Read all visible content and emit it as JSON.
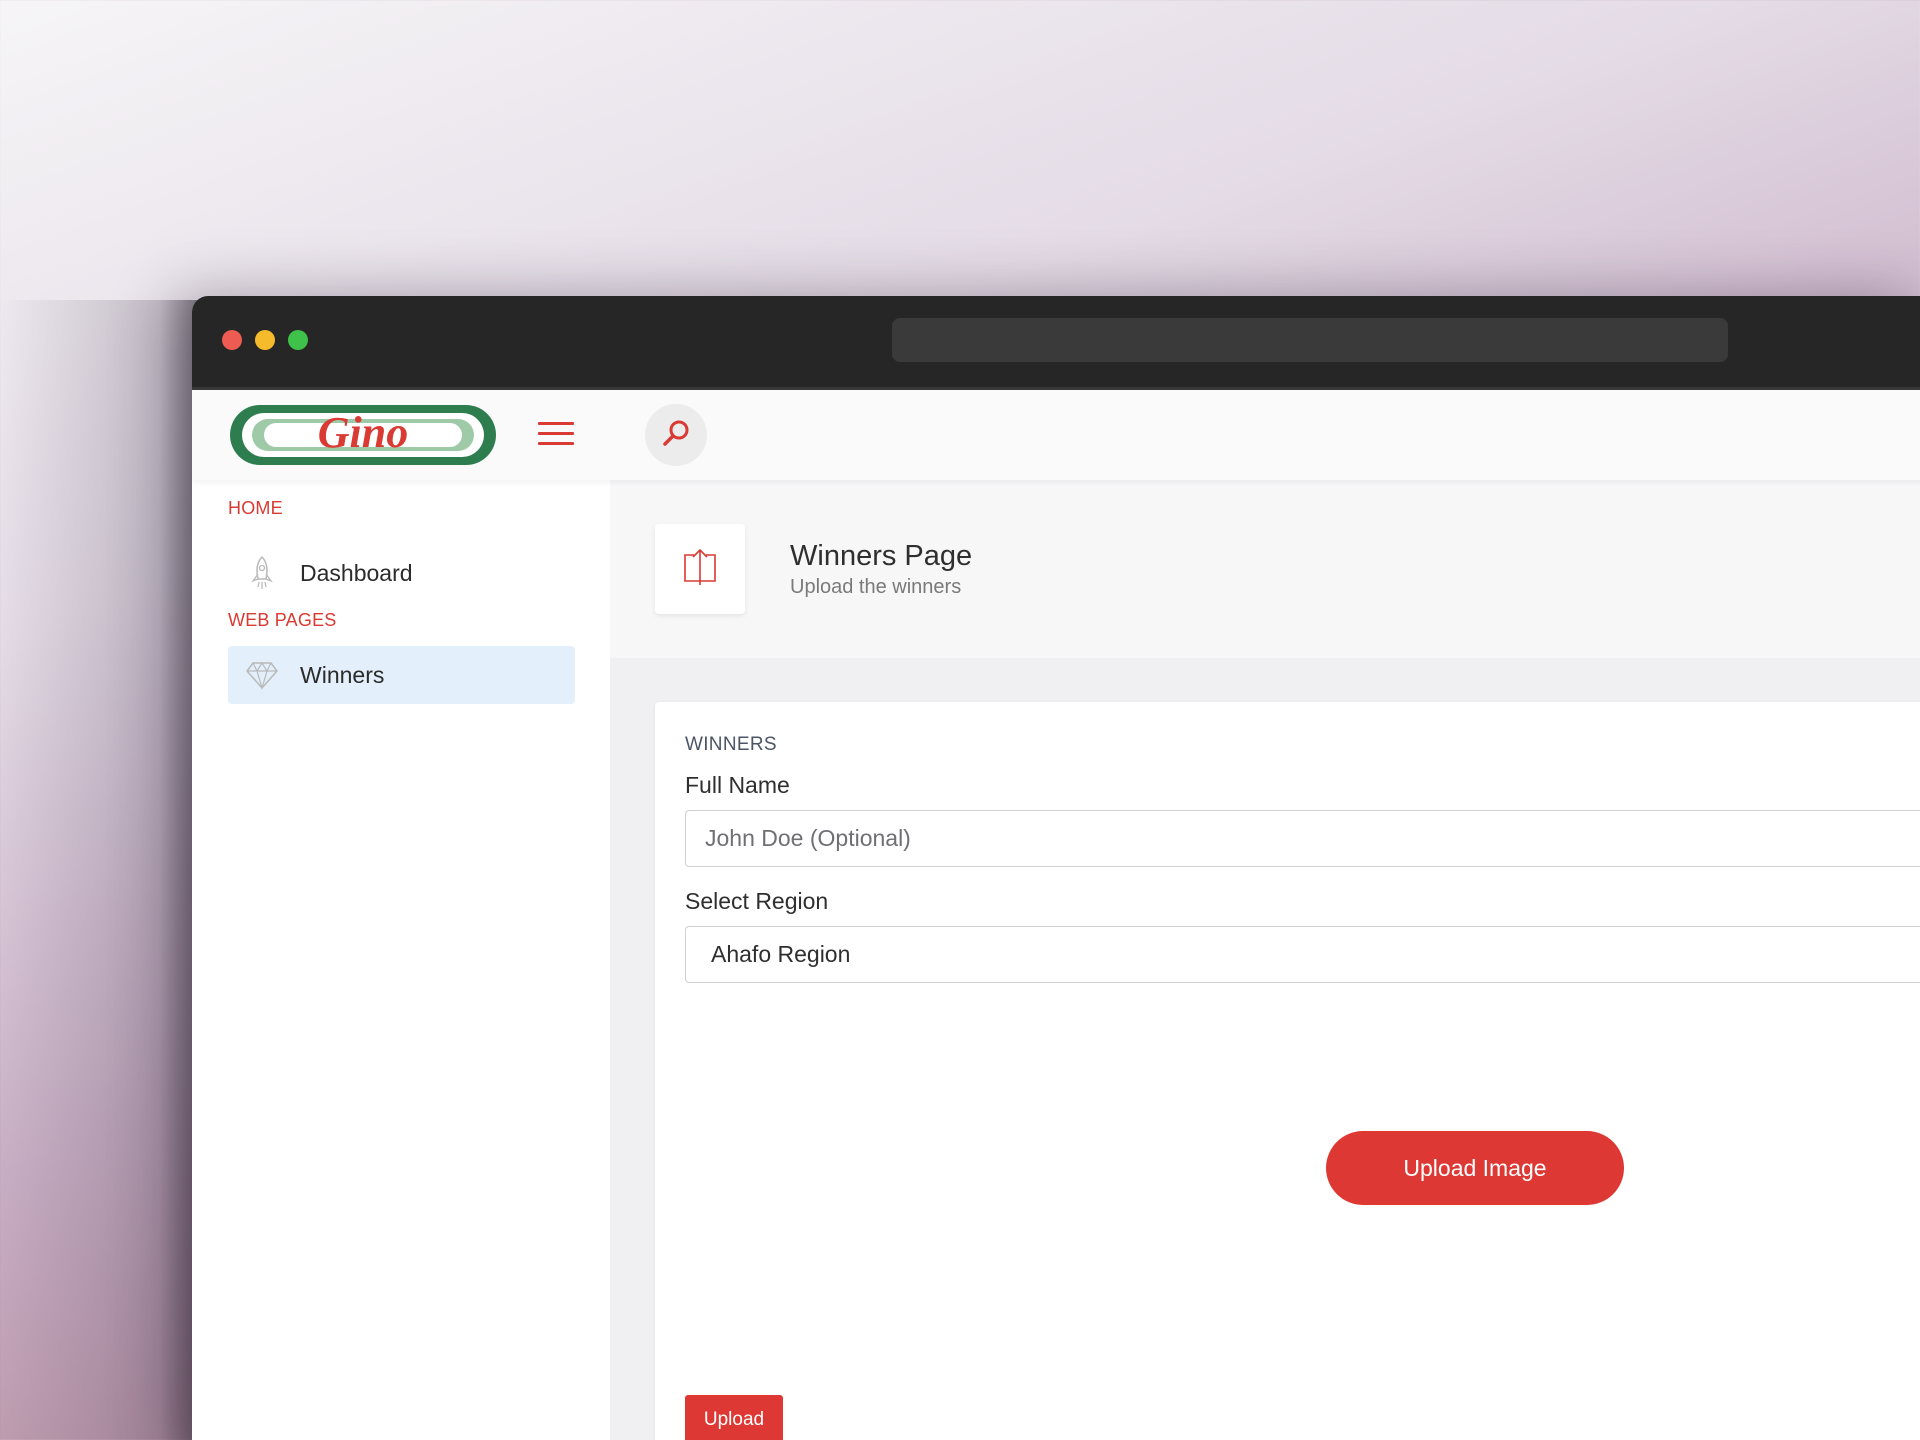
{
  "app": {
    "logo_text": "Gino"
  },
  "sidebar": {
    "sections": [
      {
        "heading": "HOME",
        "items": [
          {
            "label": "Dashboard",
            "icon": "rocket-icon"
          }
        ]
      },
      {
        "heading": "WEB PAGES",
        "items": [
          {
            "label": "Winners",
            "icon": "diamond-icon",
            "active": true
          }
        ]
      }
    ]
  },
  "header": {
    "title": "Winners Page",
    "subtitle": "Upload the winners",
    "icon": "upload-icon"
  },
  "form": {
    "card_title": "WINNERS",
    "full_name_label": "Full Name",
    "full_name_placeholder": "John Doe (Optional)",
    "region_label": "Select Region",
    "region_value": "Ahafo Region",
    "upload_image_label": "Upload Image",
    "upload_label": "Upload"
  },
  "colors": {
    "accent": "#dd3833",
    "logo_green": "#2e7d4f",
    "active_item_bg": "#e3f0fb"
  }
}
